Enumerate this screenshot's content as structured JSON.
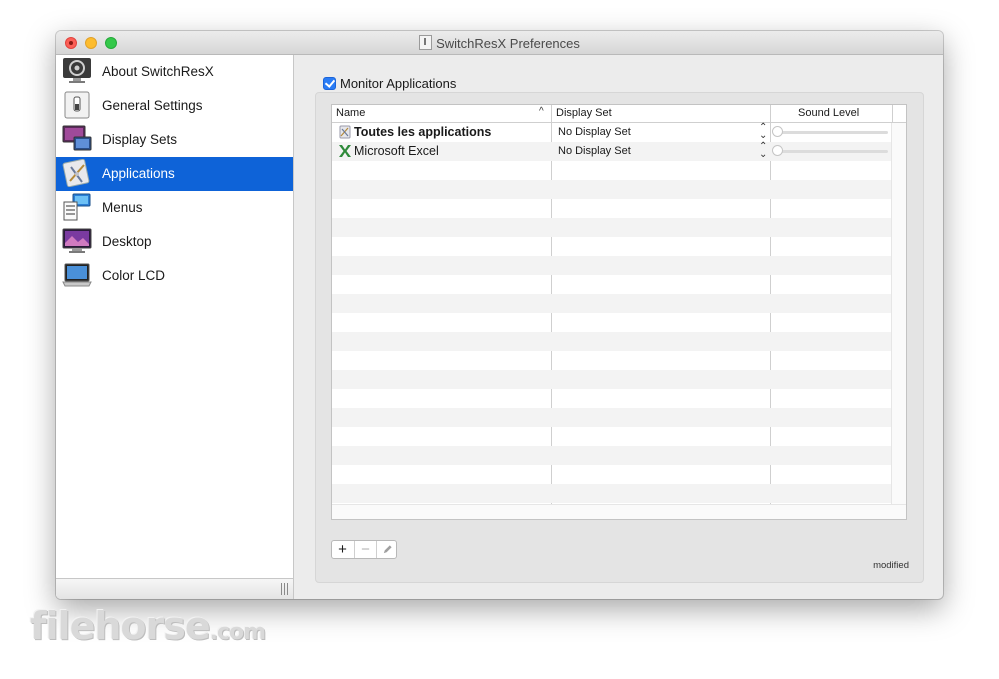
{
  "window": {
    "title": "SwitchResX Preferences"
  },
  "sidebar": {
    "items": [
      {
        "label": "About SwitchResX",
        "icon": "switchresx-app-icon"
      },
      {
        "label": "General Settings",
        "icon": "switch-settings-icon"
      },
      {
        "label": "Display Sets",
        "icon": "display-sets-icon"
      },
      {
        "label": "Applications",
        "icon": "applications-icon",
        "selected": true
      },
      {
        "label": "Menus",
        "icon": "menus-icon"
      },
      {
        "label": "Desktop",
        "icon": "desktop-icon"
      },
      {
        "label": "Color LCD",
        "icon": "laptop-display-icon"
      }
    ]
  },
  "main": {
    "monitor_label": "Monitor Applications",
    "monitor_checked": true,
    "table": {
      "columns": [
        "Name",
        "Display Set",
        "Sound Level"
      ],
      "rows": [
        {
          "name": "Toutes les applications",
          "display_set": "No Display Set",
          "bold": true,
          "icon": "all-applications-icon",
          "sound_level": 0
        },
        {
          "name": "Microsoft Excel",
          "display_set": "No Display Set",
          "bold": false,
          "icon": "excel-icon",
          "sound_level": 0
        }
      ]
    },
    "buttons": {
      "add": "+",
      "remove": "−"
    },
    "status": "modified"
  },
  "watermark": {
    "brand": "filehorse",
    "domain": ".com"
  },
  "colors": {
    "accent": "#0e63d8",
    "checkbox": "#2a7cf5"
  }
}
